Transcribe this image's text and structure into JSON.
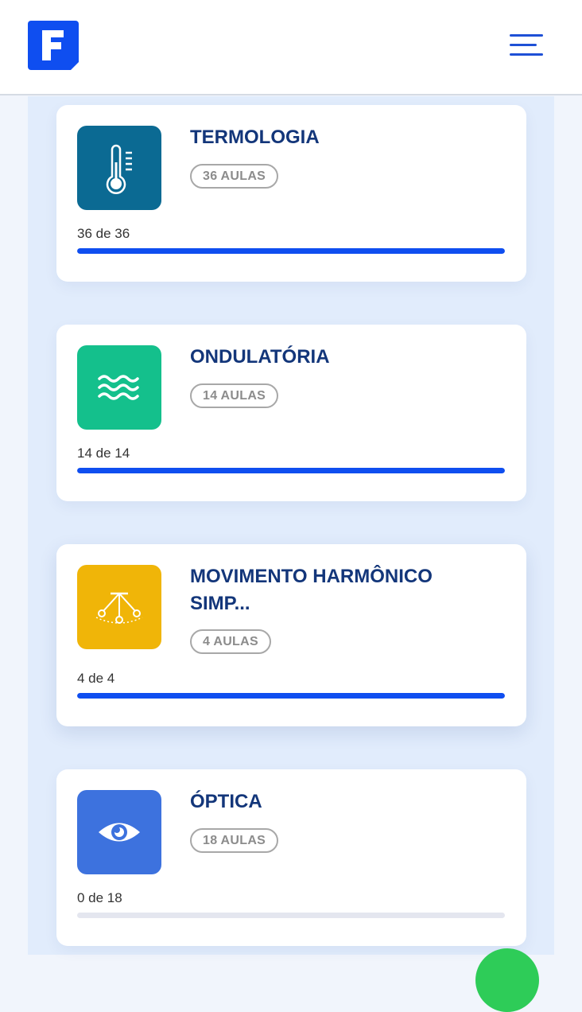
{
  "header": {
    "logo_letter": "F",
    "logo_color": "#0f4ef0",
    "menu_icon": "hamburger-menu-icon"
  },
  "courses": [
    {
      "title": "TERMOLOGIA",
      "aulas": "36 AULAS",
      "progress_text": "36 de 36",
      "progress_fraction": 1.0,
      "icon": "thermometer-icon",
      "icon_bg": "#0b6a93"
    },
    {
      "title": "ONDULATÓRIA",
      "aulas": "14 AULAS",
      "progress_text": "14 de 14",
      "progress_fraction": 1.0,
      "icon": "waves-icon",
      "icon_bg": "#14c08c"
    },
    {
      "title": "MOVIMENTO HARMÔNICO SIMP...",
      "aulas": "4 AULAS",
      "progress_text": "4 de 4",
      "progress_fraction": 1.0,
      "icon": "pendulum-icon",
      "icon_bg": "#f0b508"
    },
    {
      "title": "ÓPTICA",
      "aulas": "18 AULAS",
      "progress_text": "0 de 18",
      "progress_fraction": 0.0,
      "icon": "eye-icon",
      "icon_bg": "#3d72de"
    }
  ],
  "colors": {
    "progress": "#0f4ef0",
    "title": "#13367a",
    "panel_bg": "#e1ecfc",
    "fab": "#2ecc58"
  }
}
